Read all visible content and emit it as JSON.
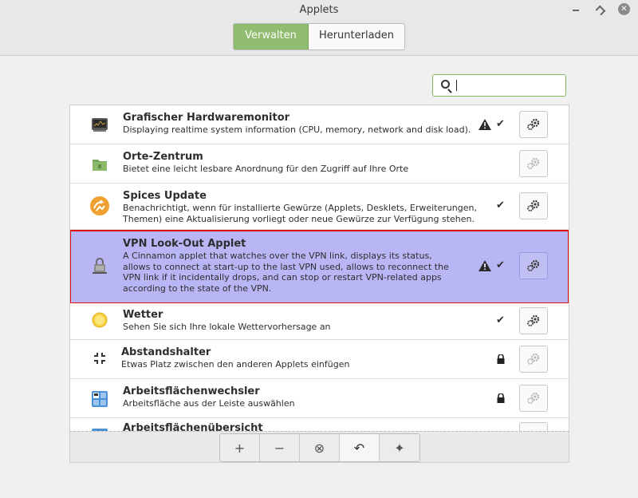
{
  "window": {
    "title": "Applets",
    "close_glyph": "✕"
  },
  "tabs": [
    {
      "label": "Verwalten",
      "active": true
    },
    {
      "label": "Herunterladen",
      "active": false
    }
  ],
  "search": {
    "value": "",
    "icon": "search-icon"
  },
  "applets": [
    {
      "name": "Grafischer Hardwaremonitor",
      "desc": "Displaying realtime system information (CPU, memory, network and disk load).",
      "warning": true,
      "enabled": true,
      "locked": false,
      "configurable": true,
      "icon": "hardware-monitor-icon"
    },
    {
      "name": "Orte-Zentrum",
      "desc": "Bietet eine leicht lesbare Anordnung für den Zugriff auf Ihre Orte",
      "warning": false,
      "enabled": false,
      "locked": false,
      "configurable": false,
      "icon": "folder-icon"
    },
    {
      "name": "Spices Update",
      "desc": "Benachrichtigt, wenn für installierte Gewürze (Applets, Desklets, Erweiterungen, Themen) eine Aktualisierung vorliegt oder neue Gewürze zur Verfügung stehen.",
      "warning": false,
      "enabled": true,
      "locked": false,
      "configurable": true,
      "icon": "spices-update-icon"
    },
    {
      "name": "VPN Look-Out Applet",
      "desc": "A Cinnamon applet that watches over the VPN link, displays its status, allows to connect at start-up to the last VPN used, allows to reconnect the VPN link if it incidentally drops, and can stop or restart VPN-related apps according to the state of the VPN.",
      "warning": true,
      "enabled": true,
      "locked": false,
      "configurable": true,
      "selected": true,
      "icon": "vpn-lock-icon"
    },
    {
      "name": "Wetter",
      "desc": "Sehen Sie sich Ihre lokale Wettervorhersage an",
      "warning": false,
      "enabled": true,
      "locked": false,
      "configurable": true,
      "icon": "weather-sun-icon"
    },
    {
      "name": "Abstandshalter",
      "desc": "Etwas Platz zwischen den anderen Applets einfügen",
      "warning": false,
      "enabled": false,
      "locked": true,
      "configurable": false,
      "icon": "spacer-icon"
    },
    {
      "name": "Arbeitsflächenwechsler",
      "desc": "Arbeitsfläche aus der Leiste auswählen",
      "warning": false,
      "enabled": false,
      "locked": true,
      "configurable": false,
      "icon": "workspace-switcher-icon"
    },
    {
      "name": "Arbeitsflächenübersicht",
      "desc": "",
      "warning": false,
      "enabled": false,
      "locked": false,
      "configurable": false,
      "icon": "workspace-overview-icon"
    }
  ],
  "toolbar": {
    "add": "+",
    "remove": "−",
    "uninstall": "⊗",
    "restore": "↶",
    "more": "✦"
  },
  "colors": {
    "accent": "#8fbc6e",
    "selected_row": "#b8b6f5",
    "selection_outline": "#e01010"
  }
}
